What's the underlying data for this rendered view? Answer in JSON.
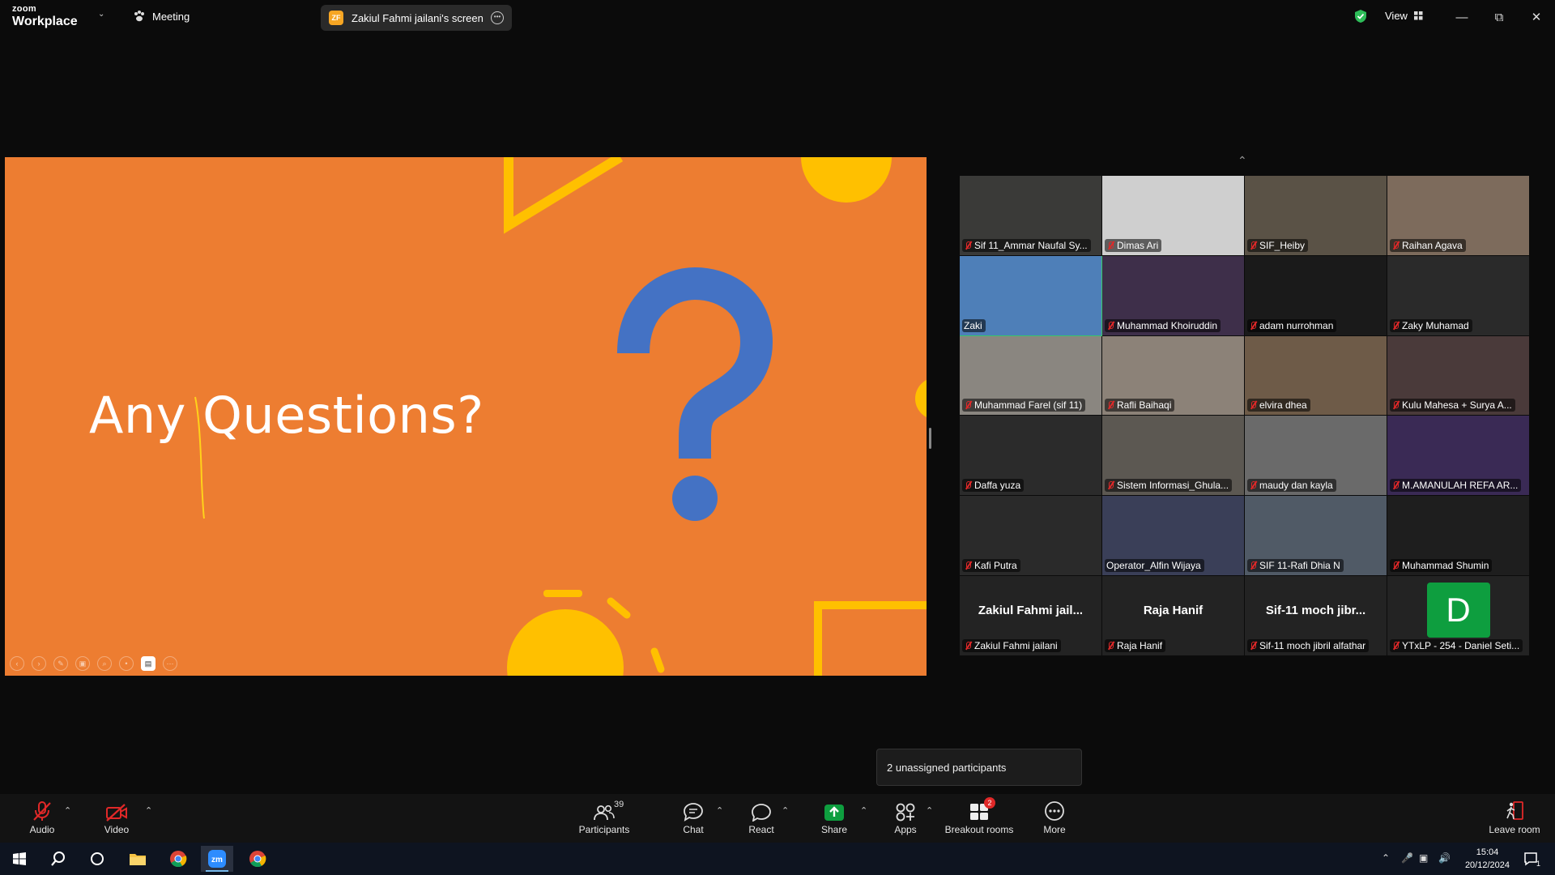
{
  "titlebar": {
    "logo_line1": "zoom",
    "logo_line2": "Workplace",
    "meeting_label": "Meeting",
    "screen_share_badge": "ZF",
    "screen_share_label": "Zakiul Fahmi jailani's screen",
    "view_label": "View"
  },
  "slide": {
    "title": "Any Questions?"
  },
  "gallery": [
    {
      "name": "Sif 11_Ammar Naufal Sy...",
      "muted": true
    },
    {
      "name": "Dimas Ari",
      "muted": true
    },
    {
      "name": "SIF_Heiby",
      "muted": true
    },
    {
      "name": "Raihan Agava",
      "muted": true
    },
    {
      "name": "Zaki",
      "muted": false,
      "active": true
    },
    {
      "name": "Muhammad Khoiruddin",
      "muted": true
    },
    {
      "name": "adam nurrohman",
      "muted": true
    },
    {
      "name": "Zaky Muhamad",
      "muted": true
    },
    {
      "name": "Muhammad Farel (sif 11)",
      "muted": true
    },
    {
      "name": "Rafli Baihaqi",
      "muted": true
    },
    {
      "name": "elvira dhea",
      "muted": true
    },
    {
      "name": "Kulu Mahesa + Surya A...",
      "muted": true
    },
    {
      "name": "Daffa yuza",
      "muted": true
    },
    {
      "name": "Sistem Informasi_Ghula...",
      "muted": true
    },
    {
      "name": "maudy dan kayla",
      "muted": true
    },
    {
      "name": "M.AMANULAH REFA AR...",
      "muted": true
    },
    {
      "name": "Kafi Putra",
      "muted": true
    },
    {
      "name": "Operator_Alfin Wijaya",
      "muted": false
    },
    {
      "name": "SIF 11-Rafi Dhia N",
      "muted": true
    },
    {
      "name": "Muhammad Shumin",
      "muted": true
    },
    {
      "name": "Zakiul Fahmi jailani",
      "display": "Zakiul  Fahmi  jail...",
      "muted": true
    },
    {
      "name": "Raja Hanif",
      "display": "Raja Hanif",
      "muted": true
    },
    {
      "name": "Sif-11 moch jibril alfathar",
      "display": "Sif-11  moch  jibr...",
      "muted": true
    },
    {
      "name": "YTxLP - 254 - Daniel Seti...",
      "letter": "D",
      "muted": true
    }
  ],
  "tooltip": {
    "text": "2 unassigned participants"
  },
  "toolbar": {
    "audio": "Audio",
    "video": "Video",
    "participants": "Participants",
    "participants_count": "39",
    "chat": "Chat",
    "react": "React",
    "share": "Share",
    "apps": "Apps",
    "breakout": "Breakout rooms",
    "breakout_badge": "2",
    "more": "More",
    "leave": "Leave room"
  },
  "taskbar": {
    "time": "15:04",
    "date": "20/12/2024",
    "notification_count": "1"
  },
  "colors": {
    "slide_bg": "#ed7d31",
    "slide_blue": "#4472c4",
    "slide_yellow": "#ffc000",
    "active_speaker": "#35c76a",
    "share_green": "#0e9e3f",
    "muted_red": "#e02828"
  }
}
